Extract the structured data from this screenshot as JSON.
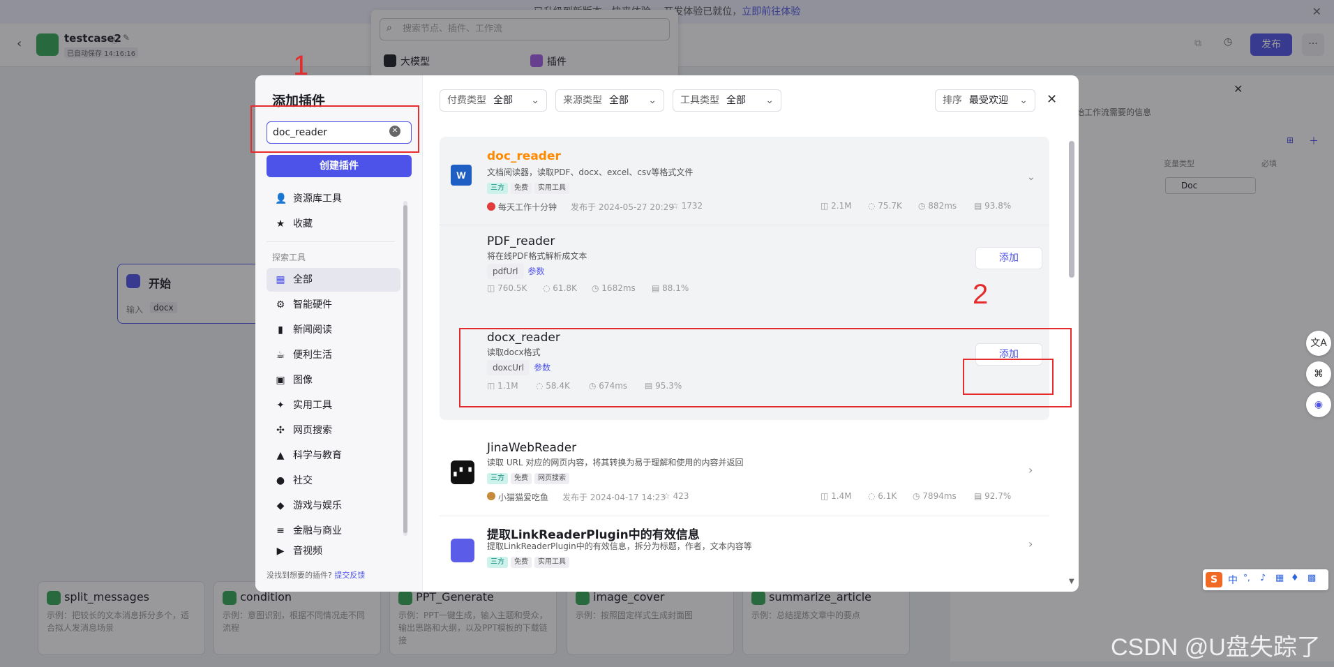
{
  "notice": {
    "text": "已升级到新版本，快来体验 ，开发体验已就位，",
    "link": "立即前往体验"
  },
  "topbar": {
    "title": "testcase2",
    "autosave": "已自动保存 14:16:16",
    "publish": "发布"
  },
  "search_popup": {
    "placeholder": "搜索节点、插件、工作流",
    "tab_llm": "大模型",
    "tab_plugin": "插件"
  },
  "start_node": {
    "title": "开始",
    "input_label": "输入",
    "input_value": "docx"
  },
  "right_panel": {
    "desc": "始工作流需要的信息",
    "col_type": "变量类型",
    "col_required": "必填",
    "type_value": "Doc"
  },
  "bottom_nodes": [
    {
      "title": "split_messages",
      "desc": "示例：把较长的文本消息拆分多个，适合拟人发消息场景"
    },
    {
      "title": "condition",
      "desc": "示例：意图识别，根据不同情况走不同流程"
    },
    {
      "title": "PPT_Generate",
      "desc": "示例：PPT一键生成，输入主题和受众，输出思路和大纲，以及PPT模板的下载链接"
    },
    {
      "title": "image_cover",
      "desc": "示例：按照固定样式生成封面图"
    },
    {
      "title": "summarize_article",
      "desc": "示例：总结提炼文章中的要点"
    }
  ],
  "modal": {
    "title": "添加插件",
    "search_value": "doc_reader",
    "create_btn": "创建插件",
    "nav_top": [
      {
        "label": "资源库工具",
        "icon": "user-icon"
      },
      {
        "label": "收藏",
        "icon": "star-icon"
      }
    ],
    "section": "探索工具",
    "categories": [
      "全部",
      "智能硬件",
      "新闻阅读",
      "便利生活",
      "图像",
      "实用工具",
      "网页搜索",
      "科学与教育",
      "社交",
      "游戏与娱乐",
      "金融与商业",
      "音视频"
    ],
    "footer_q": "没找到想要的插件?",
    "footer_link": "提交反馈",
    "filters": [
      {
        "k": "付费类型",
        "v": "全部"
      },
      {
        "k": "来源类型",
        "v": "全部"
      },
      {
        "k": "工具类型",
        "v": "全部"
      }
    ],
    "sort": {
      "k": "排序",
      "v": "最受欢迎"
    },
    "plugins": [
      {
        "name": "doc_reader",
        "desc": "文档阅读器，读取PDF、docx、excel、csv等格式文件",
        "tags": [
          "三方",
          "免费",
          "实用工具"
        ],
        "author": "每天工作十分钟",
        "date": "发布于 2024-05-27 20:29",
        "stars": "1732",
        "s1": "2.1M",
        "s2": "75.7K",
        "s3": "882ms",
        "s4": "93.8%"
      },
      {
        "name": "JinaWebReader",
        "desc": "读取 URL 对应的网页内容，将其转换为易于理解和使用的内容并返回",
        "tags": [
          "三方",
          "免费",
          "网页搜索"
        ],
        "author": "小猫猫爱吃鱼",
        "date": "发布于 2024-04-17 14:23",
        "stars": "423",
        "s1": "1.4M",
        "s2": "6.1K",
        "s3": "7894ms",
        "s4": "92.7%"
      },
      {
        "name": "提取LinkReaderPlugin中的有效信息",
        "desc": "提取LinkReaderPlugin中的有效信息，拆分为标题，作者，文本内容等",
        "tags": [
          "三方",
          "免费",
          "实用工具"
        ]
      }
    ],
    "tools": [
      {
        "name": "PDF_reader",
        "desc": "将在线PDF格式解析成文本",
        "param": "pdfUrl",
        "param_link": "参数",
        "s1": "760.5K",
        "s2": "61.8K",
        "s3": "1682ms",
        "s4": "88.1%",
        "add": "添加"
      },
      {
        "name": "docx_reader",
        "desc": "读取docx格式",
        "param": "doxcUrl",
        "param_link": "参数",
        "s1": "1.1M",
        "s2": "58.4K",
        "s3": "674ms",
        "s4": "95.3%",
        "add": "添加"
      }
    ]
  },
  "annotations": {
    "one": "1",
    "two": "2"
  },
  "watermark": "CSDN @U盘失踪了",
  "ime": [
    "中",
    "°,"
  ]
}
